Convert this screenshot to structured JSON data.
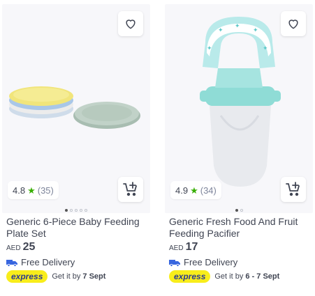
{
  "products": [
    {
      "title": "Generic 6-Piece Baby Feeding Plate Set",
      "rating": "4.8",
      "rating_count": "(35)",
      "currency": "AED",
      "price": "25",
      "delivery": "Free Delivery",
      "express_label": "express",
      "get_it_prefix": "Get it by",
      "get_it_date": "7 Sept",
      "image_dots": 5,
      "active_dot": 1
    },
    {
      "title": "Generic Fresh Food And Fruit Feeding Pacifier",
      "rating": "4.9",
      "rating_count": "(34)",
      "currency": "AED",
      "price": "17",
      "delivery": "Free Delivery",
      "express_label": "express",
      "get_it_prefix": "Get it by",
      "get_it_date": "6 - 7 Sept",
      "image_dots": 2,
      "active_dot": 1
    }
  ],
  "colors": {
    "star": "#38ae04",
    "express_bg": "#f8ed1b",
    "express_text": "#2b3a8f",
    "delivery_icon": "#3866df",
    "text": "#404553"
  },
  "icons": {
    "wishlist": "heart-icon",
    "cart": "add-to-cart-icon",
    "delivery": "truck-icon",
    "star": "star-icon"
  }
}
